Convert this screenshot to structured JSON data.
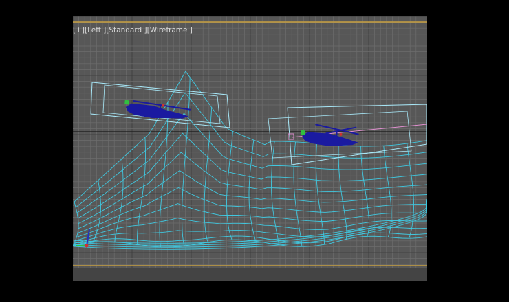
{
  "viewport": {
    "label_parts": [
      "[+]",
      "[Left ]",
      "[Standard ]",
      "[Wireframe ]"
    ],
    "background_color": "#575757",
    "grid_color": "#6d6d6d",
    "major_grid_color": "#3a3a3a",
    "horizon_color": "#1a1a1a",
    "border_line_color": "#c8a040",
    "wire_color": "#40c8e0",
    "box_color": "#a8e8f8",
    "helicopter_color": "#1a1aa0",
    "path_color": "#e090d0"
  },
  "scene_objects": [
    {
      "name": "helicopter-left",
      "icon": "helicopter-icon"
    },
    {
      "name": "helicopter-right",
      "icon": "helicopter-icon"
    },
    {
      "name": "terrain-mesh",
      "icon": "mesh-icon"
    },
    {
      "name": "axis-gizmo",
      "icon": "axis-tripod-icon"
    }
  ]
}
